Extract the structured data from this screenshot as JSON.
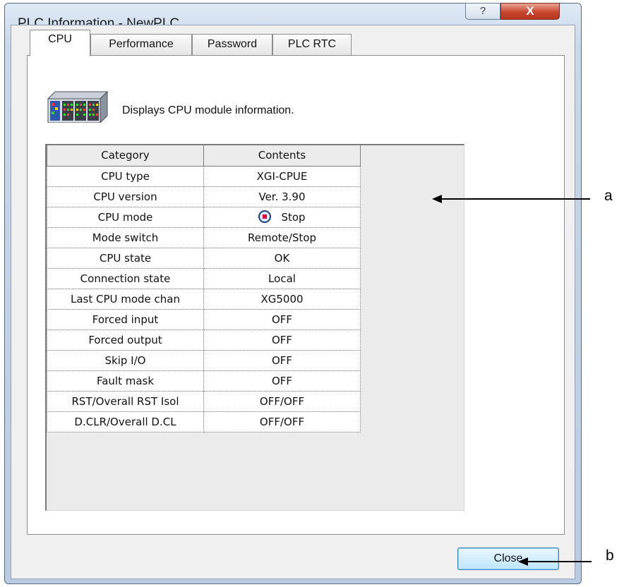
{
  "window": {
    "title": "PLC Information - NewPLC",
    "help_glyph": "?",
    "close_glyph": "X"
  },
  "tabs": [
    {
      "label": "CPU",
      "active": true
    },
    {
      "label": "Performance",
      "active": false
    },
    {
      "label": "Password",
      "active": false
    },
    {
      "label": "PLC RTC",
      "active": false
    }
  ],
  "panel": {
    "icon": "cpu-module-icon",
    "description": "Displays CPU module information."
  },
  "grid": {
    "headers": [
      "Category",
      "Contents"
    ],
    "rows": [
      {
        "category": "CPU type",
        "contents": "XGI-CPUE"
      },
      {
        "category": "CPU version",
        "contents": "Ver. 3.90"
      },
      {
        "category": "CPU mode",
        "contents": "Stop",
        "icon": "stop-icon"
      },
      {
        "category": "Mode switch",
        "contents": "Remote/Stop"
      },
      {
        "category": "CPU state",
        "contents": "OK"
      },
      {
        "category": "Connection state",
        "contents": "Local"
      },
      {
        "category": "Last CPU mode chan",
        "contents": "XG5000"
      },
      {
        "category": "Forced input",
        "contents": "OFF"
      },
      {
        "category": "Forced output",
        "contents": "OFF"
      },
      {
        "category": "Skip I/O",
        "contents": "OFF"
      },
      {
        "category": "Fault mask",
        "contents": "OFF"
      },
      {
        "category": "RST/Overall RST Isol",
        "contents": "OFF/OFF"
      },
      {
        "category": "D.CLR/Overall D.CL",
        "contents": "OFF/OFF"
      }
    ]
  },
  "buttons": {
    "close_label": "Close"
  },
  "annotations": {
    "a": "a",
    "b": "b"
  }
}
